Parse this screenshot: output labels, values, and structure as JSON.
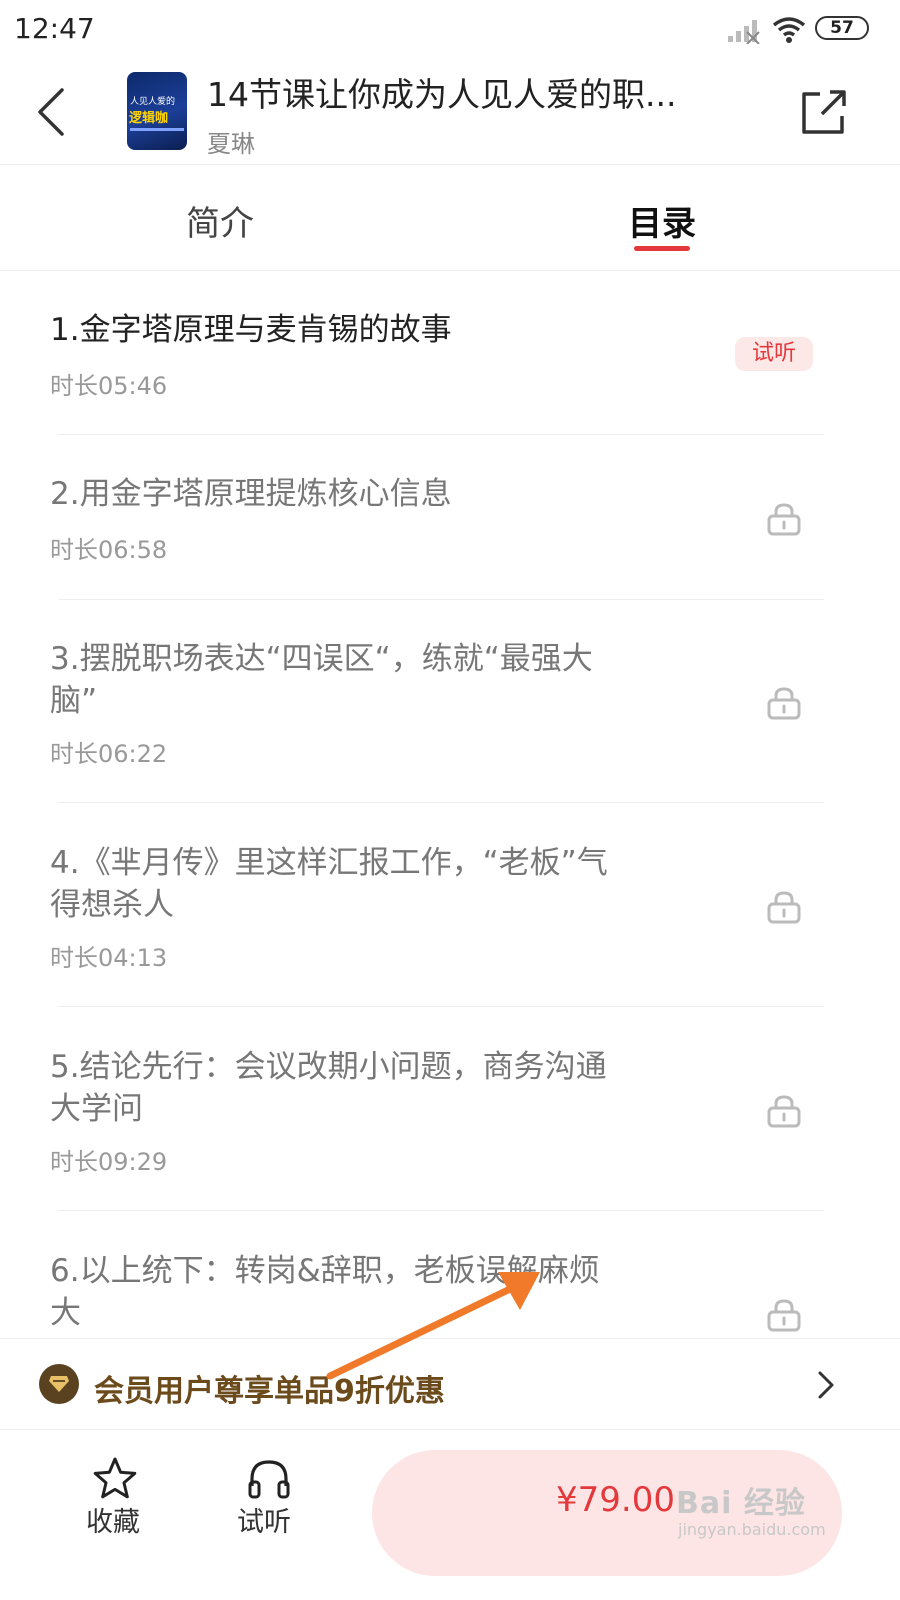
{
  "status_bar": {
    "time": "12:47",
    "battery": "57"
  },
  "header": {
    "title": "14节课让你成为人见人爱的职...",
    "author": "夏琳",
    "cover_text_top": "人见人爱的",
    "cover_text_main": "逻辑咖"
  },
  "tabs": [
    {
      "label": "简介",
      "active": false
    },
    {
      "label": "目录",
      "active": true
    }
  ],
  "lessons": [
    {
      "title": "1.金字塔原理与麦肯锡的故事",
      "duration": "时长05:46",
      "badge": "试听",
      "locked": false
    },
    {
      "title": "2.用金字塔原理提炼核心信息",
      "duration": "时长06:58",
      "locked": true
    },
    {
      "title": "3.摆脱职场表达“四误区“，练就“最强大脑”",
      "duration": "时长06:22",
      "locked": true
    },
    {
      "title": "4.《芈月传》里这样汇报工作，“老板”气得想杀人",
      "duration": "时长04:13",
      "locked": true
    },
    {
      "title": "5.结论先行：会议改期小问题，商务沟通大学问",
      "duration": "时长09:29",
      "locked": true
    },
    {
      "title": "6.以上统下：转岗&辞职，老板误解麻烦大",
      "duration": "",
      "locked": true
    }
  ],
  "promo": {
    "text": "会员用户尊享单品9折优惠"
  },
  "bottom_bar": {
    "favorite_label": "收藏",
    "trial_label": "试听",
    "price": "¥79.00"
  },
  "watermark": {
    "brand": "Bai 经验",
    "site": "jingyan.baidu.com"
  },
  "colors": {
    "accent": "#e4393c",
    "promo_text": "#6b4a1c",
    "buy_bg": "#fde5e5",
    "annotation_arrow": "#f07a2a"
  }
}
